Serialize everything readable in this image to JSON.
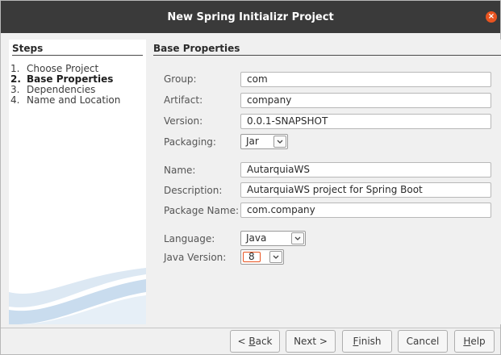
{
  "window": {
    "title": "New Spring Initializr Project",
    "close_glyph": "×"
  },
  "steps": {
    "header": "Steps",
    "items": [
      {
        "num": "1.",
        "label": "Choose Project",
        "active": false
      },
      {
        "num": "2.",
        "label": "Base Properties",
        "active": true
      },
      {
        "num": "3.",
        "label": "Dependencies",
        "active": false
      },
      {
        "num": "4.",
        "label": "Name and Location",
        "active": false
      }
    ]
  },
  "form": {
    "header": "Base Properties",
    "group": {
      "label": "Group:",
      "value": "com"
    },
    "artifact": {
      "label": "Artifact:",
      "value": "company"
    },
    "version": {
      "label": "Version:",
      "value": "0.0.1-SNAPSHOT"
    },
    "packaging": {
      "label": "Packaging:",
      "value": "Jar"
    },
    "name": {
      "label": "Name:",
      "value": "AutarquiaWS"
    },
    "description": {
      "label": "Description:",
      "value": "AutarquiaWS project for Spring Boot"
    },
    "package_name": {
      "label": "Package Name:",
      "value": "com.company"
    },
    "language": {
      "label": "Language:",
      "value": "Java"
    },
    "java_version": {
      "label": "Java Version:",
      "value": "8"
    }
  },
  "buttons": {
    "back": {
      "prefix": "< ",
      "mnemonic": "B",
      "rest": "ack"
    },
    "next": {
      "label": "Next >"
    },
    "finish": {
      "mnemonic": "F",
      "rest": "inish"
    },
    "cancel": {
      "label": "Cancel"
    },
    "help": {
      "mnemonic": "H",
      "rest": "elp"
    }
  },
  "colors": {
    "accent": "#e95420",
    "titlebar": "#3a3a3a"
  },
  "icons": {
    "close": "close-icon",
    "dropdown": "chevron-down-icon",
    "decoration": "swoosh-graphic"
  }
}
